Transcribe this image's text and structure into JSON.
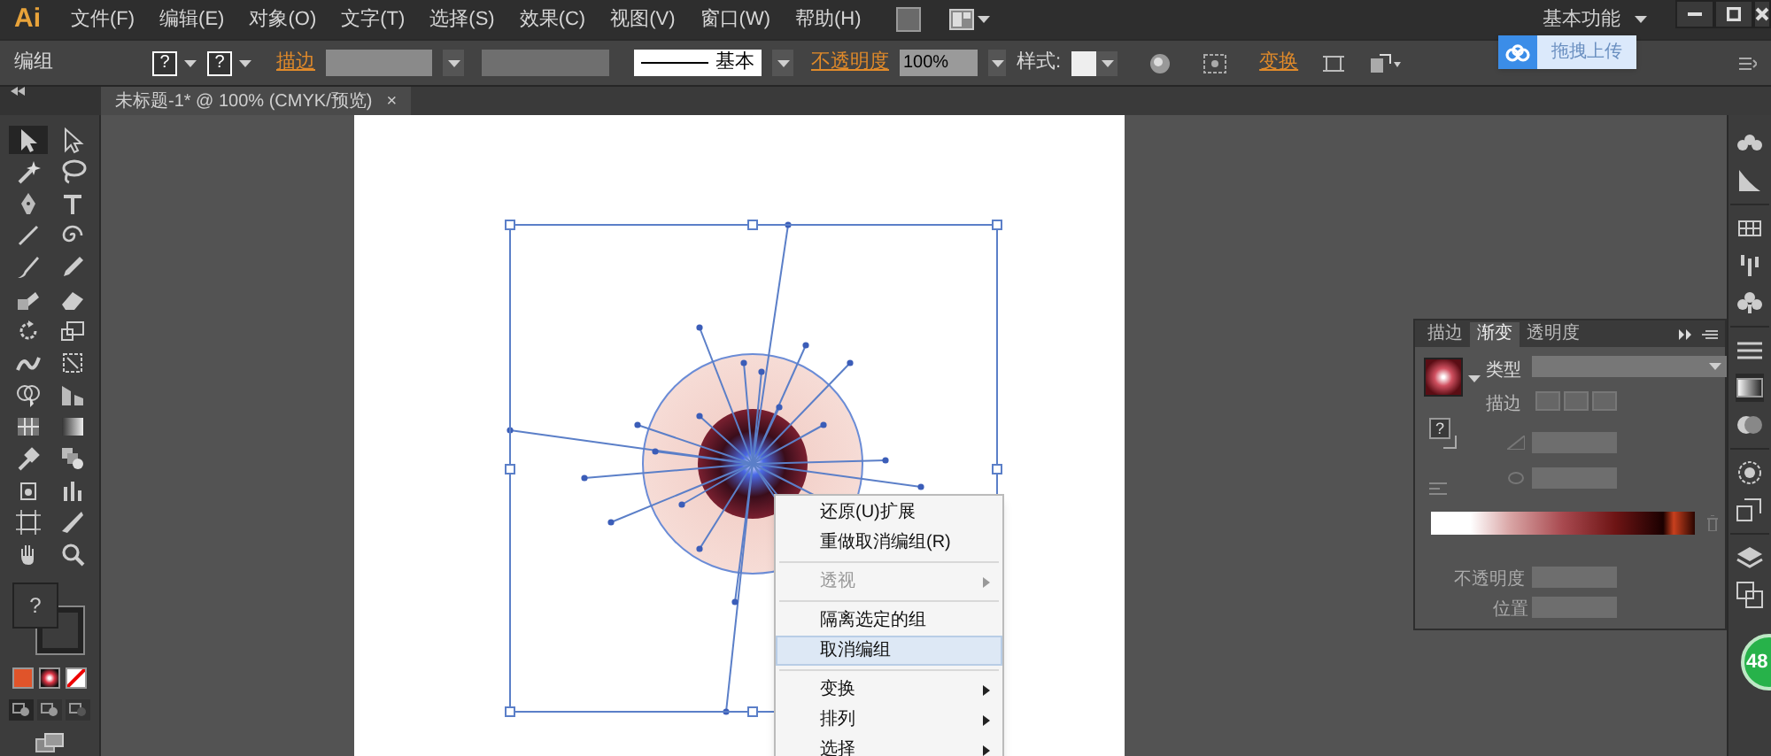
{
  "app": {
    "logo": "Ai"
  },
  "menu": [
    "文件(F)",
    "编辑(E)",
    "对象(O)",
    "文字(T)",
    "选择(S)",
    "效果(C)",
    "视图(V)",
    "窗口(W)",
    "帮助(H)"
  ],
  "workspace": {
    "label": "基本功能"
  },
  "upload_popup": {
    "label": "拖拽上传"
  },
  "control_bar": {
    "selection": "编组",
    "fill_swatch": "?",
    "stroke_swatch": "?",
    "stroke_label": "描边",
    "stroke_style": "基本",
    "opacity_label": "不透明度",
    "opacity_value": "100%",
    "style_label": "样式:",
    "transform_label": "变换"
  },
  "document_tab": {
    "title": "未标题-1* @ 100% (CMYK/预览)",
    "close": "×"
  },
  "tools": [
    {
      "kind": "selection",
      "selected": true
    },
    {
      "kind": "direct-selection",
      "selected": false
    },
    {
      "kind": "magic-wand",
      "selected": false
    },
    {
      "kind": "lasso",
      "selected": false
    },
    {
      "kind": "pen",
      "selected": false
    },
    {
      "kind": "type",
      "selected": false
    },
    {
      "kind": "line",
      "selected": false
    },
    {
      "kind": "spiral",
      "selected": false
    },
    {
      "kind": "brush",
      "selected": false
    },
    {
      "kind": "pencil",
      "selected": false
    },
    {
      "kind": "blob",
      "selected": false
    },
    {
      "kind": "eraser",
      "selected": false
    },
    {
      "kind": "rotate",
      "selected": false
    },
    {
      "kind": "scale",
      "selected": false
    },
    {
      "kind": "warp",
      "selected": false
    },
    {
      "kind": "free-transform",
      "selected": false
    },
    {
      "kind": "shape-builder",
      "selected": false
    },
    {
      "kind": "perspective",
      "selected": false
    },
    {
      "kind": "mesh",
      "selected": false
    },
    {
      "kind": "gradient",
      "selected": false
    },
    {
      "kind": "eyedropper",
      "selected": false
    },
    {
      "kind": "blend",
      "selected": false
    },
    {
      "kind": "symbol",
      "selected": false
    },
    {
      "kind": "graph",
      "selected": false
    },
    {
      "kind": "artboard",
      "selected": false
    },
    {
      "kind": "slice",
      "selected": false
    },
    {
      "kind": "hand",
      "selected": false
    },
    {
      "kind": "zoom",
      "selected": false
    }
  ],
  "fill_indicator": {
    "label": "?"
  },
  "context_menu": [
    {
      "kind": "item",
      "label": "还原(U)扩展",
      "disabled": false,
      "submenu": false,
      "selected": false
    },
    {
      "kind": "item",
      "label": "重做取消编组(R)",
      "disabled": false,
      "submenu": false,
      "selected": false
    },
    {
      "kind": "separator"
    },
    {
      "kind": "item",
      "label": "透视",
      "disabled": true,
      "submenu": true,
      "selected": false
    },
    {
      "kind": "separator"
    },
    {
      "kind": "item",
      "label": "隔离选定的组",
      "disabled": false,
      "submenu": false,
      "selected": false
    },
    {
      "kind": "item",
      "label": "取消编组",
      "disabled": false,
      "submenu": false,
      "selected": true
    },
    {
      "kind": "separator"
    },
    {
      "kind": "item",
      "label": "变换",
      "disabled": false,
      "submenu": true,
      "selected": false
    },
    {
      "kind": "item",
      "label": "排列",
      "disabled": false,
      "submenu": true,
      "selected": false
    },
    {
      "kind": "item",
      "label": "选择",
      "disabled": false,
      "submenu": true,
      "selected": false
    }
  ],
  "gradient_panel": {
    "tabs": [
      {
        "label": "描边",
        "selected": false
      },
      {
        "label": "渐变",
        "selected": true
      },
      {
        "label": "透明度",
        "selected": false
      }
    ],
    "type_label": "类型",
    "stroke_label": "描边",
    "fill_swatch": "?",
    "opacity_label": "不透明度",
    "location_label": "位置"
  },
  "floating_badge": {
    "value": "48"
  }
}
